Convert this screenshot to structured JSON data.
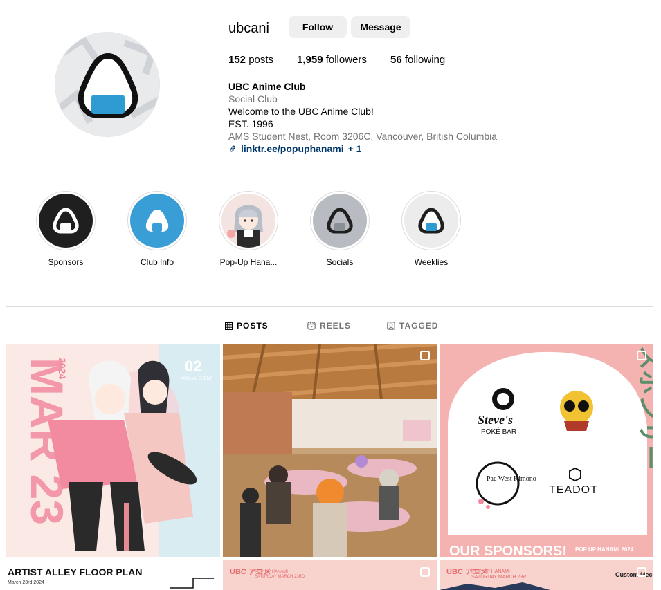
{
  "profile": {
    "username": "ubcani",
    "follow_label": "Follow",
    "message_label": "Message",
    "stats": {
      "posts_count": "152",
      "posts_label": "posts",
      "followers_count": "1,959",
      "followers_label": "followers",
      "following_count": "56",
      "following_label": "following"
    },
    "bio": {
      "name": "UBC Anime Club",
      "category": "Social Club",
      "line1": "Welcome to the UBC Anime Club!",
      "line2": "EST. 1996",
      "address": "AMS Student Nest, Room 3206C, Vancouver, British Columbia",
      "link": "linktr.ee/popuphanami",
      "link_extra": "+ 1"
    }
  },
  "highlights": [
    {
      "label": "Sponsors",
      "bg": "#1f1f1f"
    },
    {
      "label": "Club Info",
      "bg": "#3a9ed6"
    },
    {
      "label": "Pop-Up Hana...",
      "bg": "#f6d6d3"
    },
    {
      "label": "Socials",
      "bg": "#b8bcc2"
    },
    {
      "label": "Weeklies",
      "bg": "#ececec"
    }
  ],
  "tabs": {
    "posts": "POSTS",
    "reels": "REELS",
    "tagged": "TAGGED"
  },
  "posts": {
    "p1": {
      "badge": "02",
      "badge_sub": "ANNUAL EVENT",
      "title": "ARTIST ALLEY FLOOR PLAN",
      "date": "March 23rd 2024",
      "vertical": "MAR 23",
      "year": "2024"
    },
    "p3": {
      "heading_jp": "スポンサー",
      "sponsor1": "Steve's",
      "sponsor1_sub": "POKÉ BAR",
      "sponsor3": "Pac West Kimono",
      "sponsor4": "TEADOT",
      "footer": "OUR SPONSORS!",
      "footer_sub": "POP UP HANAMI 2024"
    },
    "p5": {
      "brand": "UBC アニメ",
      "line1": "POP-UP HANAMI",
      "line2": "SATURDAY MARCH 23RD"
    },
    "p6": {
      "brand": "UBC アニメ",
      "line1": "POP-UP HANAMI",
      "line2": "SATURDAY MARCH 23RD",
      "corner": "Custom Mechanical Keyboard"
    }
  },
  "colors": {
    "accent_blue": "#3a9ed6",
    "pink": "#f4b9b6",
    "link": "#00376b",
    "grey_text": "#737373"
  }
}
